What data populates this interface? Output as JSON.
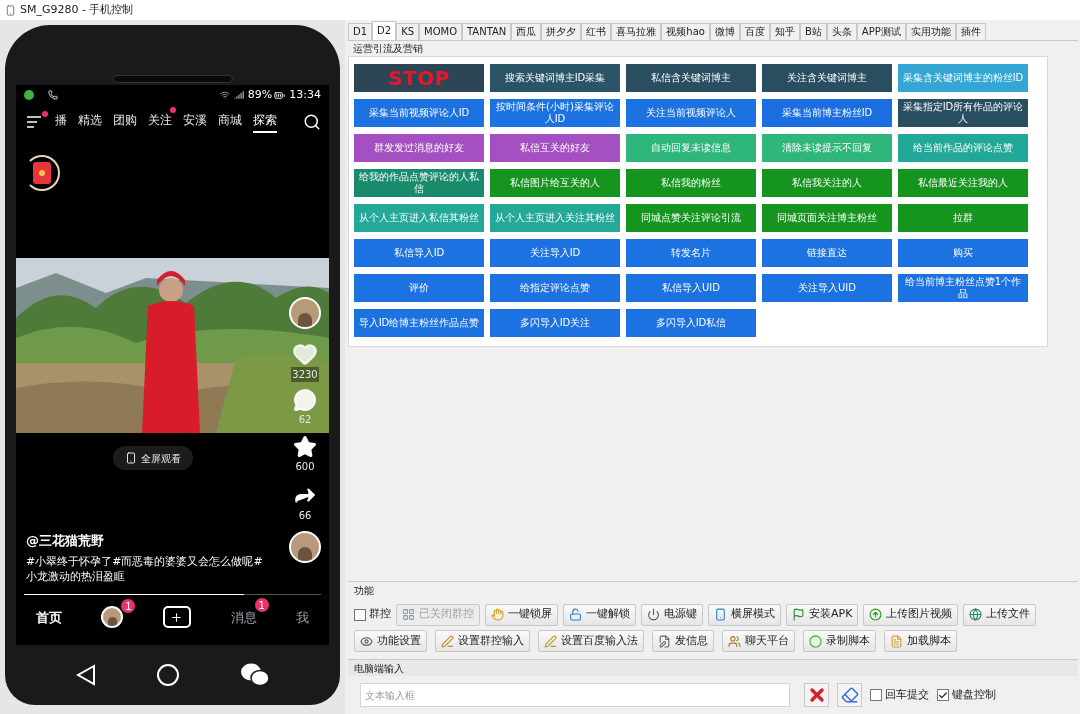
{
  "window": {
    "title": "SM_G9280  - 手机控制"
  },
  "phone": {
    "status_bar": {
      "battery": "89%",
      "time": "13:34"
    },
    "menu_dot": true,
    "top_tabs": [
      {
        "label": "播",
        "selected": false,
        "dot": false
      },
      {
        "label": "精选",
        "selected": false,
        "dot": false
      },
      {
        "label": "团购",
        "selected": false,
        "dot": false
      },
      {
        "label": "关注",
        "selected": false,
        "dot": true
      },
      {
        "label": "安溪",
        "selected": false,
        "dot": false
      },
      {
        "label": "商城",
        "selected": false,
        "dot": false
      },
      {
        "label": "探索",
        "selected": true,
        "dot": false
      }
    ],
    "actions": {
      "likes": "3230",
      "comments": "62",
      "favorites": "600",
      "shares": "66"
    },
    "fullscreen_button": "全屏观看",
    "author": "@三花猫荒野",
    "description_lines": [
      "#小翠终于怀孕了#而恶毒的婆婆又会怎么做呢#",
      "小龙激动的热泪盈眶"
    ],
    "progress": {
      "level": 0.74
    },
    "bottom_nav": [
      {
        "kind": "text",
        "label": "首页",
        "selected": true
      },
      {
        "kind": "avatar",
        "badge": "1",
        "selected": false
      },
      {
        "kind": "add",
        "selected": false
      },
      {
        "kind": "text",
        "label": "消息",
        "badge": "1",
        "selected": false
      },
      {
        "kind": "text",
        "label": "我",
        "selected": false
      }
    ]
  },
  "tabs": [
    {
      "label": "D1",
      "selected": false
    },
    {
      "label": "D2",
      "selected": true
    },
    {
      "label": "KS",
      "selected": false
    },
    {
      "label": "MOMO",
      "selected": false
    },
    {
      "label": "TANTAN",
      "selected": false
    },
    {
      "label": "西瓜",
      "selected": false
    },
    {
      "label": "拼夕夕",
      "selected": false
    },
    {
      "label": "红书",
      "selected": false
    },
    {
      "label": "喜马拉雅",
      "selected": false
    },
    {
      "label": "视频hao",
      "selected": false
    },
    {
      "label": "微博",
      "selected": false
    },
    {
      "label": "百度",
      "selected": false
    },
    {
      "label": "知乎",
      "selected": false
    },
    {
      "label": "B站",
      "selected": false
    },
    {
      "label": "头条",
      "selected": false
    },
    {
      "label": "APP测试",
      "selected": false
    },
    {
      "label": "实用功能",
      "selected": false
    },
    {
      "label": "插件",
      "selected": false
    }
  ],
  "operations": {
    "title": "运营引流及营销",
    "buttons": [
      {
        "kind": "stop",
        "label": "STOP",
        "color": "#2c4656"
      },
      {
        "kind": "action",
        "label": "搜索关键词博主ID采集",
        "color": "#2a5566"
      },
      {
        "kind": "action",
        "label": "私信含关键词博主",
        "color": "#294e60"
      },
      {
        "kind": "action",
        "label": "关注含关键词博主",
        "color": "#294e60"
      },
      {
        "kind": "action",
        "label": "采集含关键词博主的粉丝ID",
        "color": "#34a6d4"
      },
      {
        "kind": "action",
        "label": "采集当前视频评论人ID",
        "color": "#1c72e0"
      },
      {
        "kind": "action",
        "label": "按时间条件(小时)采集评论人ID",
        "color": "#1c72e0"
      },
      {
        "kind": "action",
        "label": "关注当前视频评论人",
        "color": "#1c72e0"
      },
      {
        "kind": "action",
        "label": "采集当前博主粉丝ID",
        "color": "#1c6ee0"
      },
      {
        "kind": "action",
        "label": "采集指定ID所有作品的评论人",
        "color": "#294e60"
      },
      {
        "kind": "action",
        "label": "群发发过消息的好友",
        "color": "#a450c2"
      },
      {
        "kind": "action",
        "label": "私信互关的好友",
        "color": "#a450c2"
      },
      {
        "kind": "action",
        "label": "自动回复未读信息",
        "color": "#2fb67a"
      },
      {
        "kind": "action",
        "label": "清除未读提示不回复",
        "color": "#2fb67a"
      },
      {
        "kind": "action",
        "label": "给当前作品的评论点赞",
        "color": "#22a899"
      },
      {
        "kind": "action",
        "label": "给我的作品点赞评论的人私信",
        "color": "#1a8a6c"
      },
      {
        "kind": "action",
        "label": "私信图片给互关的人",
        "color": "#15941f"
      },
      {
        "kind": "action",
        "label": "私信我的粉丝",
        "color": "#15941f"
      },
      {
        "kind": "action",
        "label": "私信我关注的人",
        "color": "#15941f"
      },
      {
        "kind": "action",
        "label": "私信最近关注我的人",
        "color": "#15941f"
      },
      {
        "kind": "action",
        "label": "从个人主页进入私信其粉丝",
        "color": "#24a898"
      },
      {
        "kind": "action",
        "label": "从个人主页进入关注其粉丝",
        "color": "#24a898"
      },
      {
        "kind": "action",
        "label": "同城点赞关注评论引流",
        "color": "#15941f"
      },
      {
        "kind": "action",
        "label": "同城页面关注博主粉丝",
        "color": "#15941f"
      },
      {
        "kind": "action",
        "label": "拉群",
        "color": "#15941f"
      },
      {
        "kind": "action",
        "label": "私信导入ID",
        "color": "#1c72e0"
      },
      {
        "kind": "action",
        "label": "关注导入ID",
        "color": "#1c72e0"
      },
      {
        "kind": "action",
        "label": "转发名片",
        "color": "#1c72e0"
      },
      {
        "kind": "action",
        "label": "链接直达",
        "color": "#1c72e0"
      },
      {
        "kind": "action",
        "label": "购买",
        "color": "#1c72e0"
      },
      {
        "kind": "action",
        "label": "评价",
        "color": "#1c72e0"
      },
      {
        "kind": "action",
        "label": "给指定评论点赞",
        "color": "#1c72e0"
      },
      {
        "kind": "action",
        "label": "私信导入UID",
        "color": "#1c72e0"
      },
      {
        "kind": "action",
        "label": "关注导入UID",
        "color": "#1c72e0"
      },
      {
        "kind": "action",
        "label": "给当前博主粉丝点赞1个作品",
        "color": "#1c72e0"
      },
      {
        "kind": "action",
        "label": "导入ID给博主粉丝作品点赞",
        "color": "#1c72e0"
      },
      {
        "kind": "action",
        "label": "多闪导入ID关注",
        "color": "#1c72e0"
      },
      {
        "kind": "action",
        "label": "多闪导入ID私信",
        "color": "#1c72e0"
      }
    ]
  },
  "functions": {
    "title": "功能",
    "group_control": {
      "label": "群控",
      "checked": false
    },
    "row_1": [
      {
        "label": "已关闭群控",
        "disabled": true
      },
      {
        "label": "一键锁屏",
        "disabled": false
      },
      {
        "label": "一键解锁",
        "disabled": false
      },
      {
        "label": "电源键",
        "disabled": false
      },
      {
        "label": "横屏模式",
        "disabled": false
      },
      {
        "label": "安装APK",
        "disabled": false
      },
      {
        "label": "上传图片视频",
        "disabled": false
      },
      {
        "label": "上传文件",
        "disabled": false
      }
    ],
    "row_2": [
      {
        "label": "功能设置",
        "disabled": false
      },
      {
        "label": "设置群控输入",
        "disabled": false
      },
      {
        "label": "设置百度输入法",
        "disabled": false
      },
      {
        "label": "发信息",
        "disabled": false
      },
      {
        "label": "聊天平台",
        "disabled": false
      },
      {
        "label": "录制脚本",
        "disabled": false
      },
      {
        "label": "加载脚本",
        "disabled": false
      }
    ]
  },
  "pc_input": {
    "title": "电脑端输入",
    "placeholder": "文本输入框",
    "options": [
      {
        "label": "回车提交",
        "checked": false
      },
      {
        "label": "键盘控制",
        "checked": true
      }
    ]
  }
}
